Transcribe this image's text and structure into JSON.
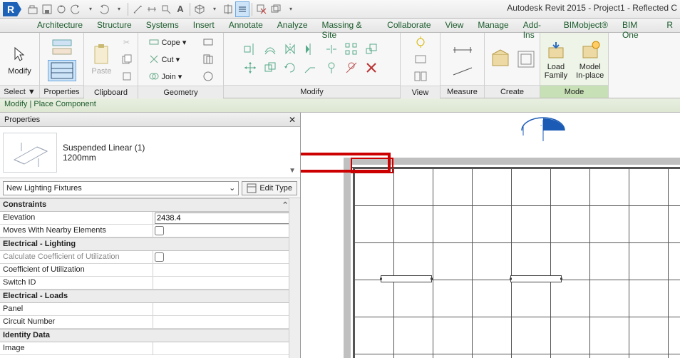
{
  "app": {
    "title": "Autodesk Revit 2015 -    Project1 - Reflected C"
  },
  "menutabs": [
    "Architecture",
    "Structure",
    "Systems",
    "Insert",
    "Annotate",
    "Analyze",
    "Massing & Site",
    "Collaborate",
    "View",
    "Manage",
    "Add-Ins",
    "BIMobject®",
    "BIM One",
    "R"
  ],
  "ribbon": {
    "select": {
      "label": "Select ▼",
      "modify": "Modify"
    },
    "properties": {
      "label": "Properties"
    },
    "clipboard": {
      "label": "Clipboard",
      "paste": "Paste"
    },
    "geometry": {
      "label": "Geometry",
      "cope": "Cope ▾",
      "cut": "Cut ▾",
      "join": "Join ▾"
    },
    "modify": {
      "label": "Modify"
    },
    "view": {
      "label": "View"
    },
    "measure": {
      "label": "Measure"
    },
    "create": {
      "label": "Create"
    },
    "mode": {
      "label": "Mode",
      "load": "Load\nFamily",
      "model": "Model\nIn-place"
    }
  },
  "contextbar": "Modify | Place Component",
  "palette": {
    "title": "Properties",
    "type": {
      "name": "Suspended Linear (1)",
      "size": "1200mm"
    },
    "combo": "New Lighting Fixtures",
    "edit": "Edit Type",
    "groups": {
      "constraints": "Constraints",
      "elec_light": "Electrical - Lighting",
      "elec_loads": "Electrical - Loads",
      "identity": "Identity Data"
    },
    "rows": {
      "elevation": {
        "k": "Elevation",
        "v": "2438.4"
      },
      "moves": {
        "k": "Moves With Nearby Elements"
      },
      "calc_coef": {
        "k": "Calculate Coefficient of Utilization"
      },
      "coef": {
        "k": "Coefficient of Utilization"
      },
      "switch": {
        "k": "Switch ID"
      },
      "panel": {
        "k": "Panel"
      },
      "circuit": {
        "k": "Circuit Number"
      },
      "image": {
        "k": "Image"
      }
    }
  }
}
